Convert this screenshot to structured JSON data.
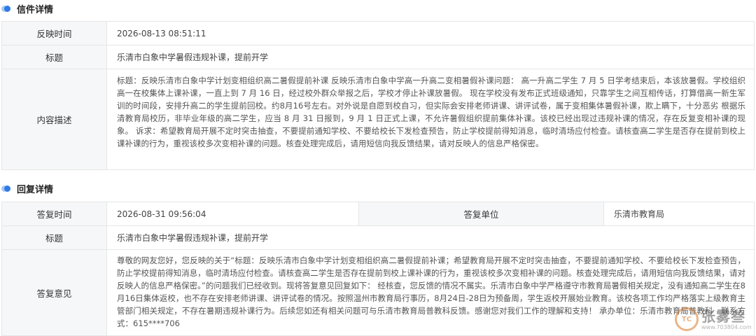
{
  "letter": {
    "section_title": "信件详情",
    "time_label": "反映时间",
    "time_value": "2026-08-13 08:51:11",
    "title_label": "标题",
    "title_value": "乐清市白象中学暑假违规补课，提前开学",
    "content_label": "内容描述",
    "content_value": "标题：反映乐清市白象中学计划变相组织高二暑假提前补课 反映乐清市白象中学高一升高二变相暑假补课问题： 高一升高二学生 7 月 5 日学考结束后，本该放暑假。学校组织高一在校集体上课补课，一直上到 7 月 16 日，经过校外群众举报之后，学校才停止补课放暑假。 现在学校没有发布正式班级通知，只靠学生之间互相传话，打算借高一新生军训的时间段，安排升高二的学生提前回校。约8月16号左右。对外说是自愿到校自习，但实际会安排老师讲课、讲评试卷，属于变相集体暑假补课，欺上瞒下，十分恶劣 根据乐清教育局校历，非毕业年级的高二学生，应当 8 月 31 日报到，9 月 1 日正式上课，不允许暑假组织提前集体补课。该校已经出现过违规补课的情况，存在反复变相补课的现象。 诉求：希望教育局开展不定时突击抽查，不要提前通知学校、不要给校长下发检查预告，防止学校提前得知消息，临时清场应付检查。请核查高二学生是否存在提前到校上课补课的行为，重视该校多次变相补课的问题。核查处理完成后，请用短信向我反馈结果，请对反映人的信息严格保密。"
  },
  "reply": {
    "section_title": "回复详情",
    "time_label": "答复时间",
    "time_value": "2026-08-31 09:56:04",
    "unit_label": "答复单位",
    "unit_value": "乐清市教育局",
    "title_label": "标题",
    "title_value": "乐清市白象中学暑假违规补课，提前开学",
    "opinion_label": "答复意见",
    "opinion_value": "尊敬的网友您好，您反映的关于“标题：反映乐清市白象中学计划变相组织高二暑假提前补课；希望教育局开展不定时突击抽查，不要提前通知学校、不要给校长下发检查预告，防止学校提前得知消息，临时清场应付检查。请核查高二学生是否存在提前到校上课补课的行为，重视该校多次变相补课的问题。核查处理完成后，请用短信向我反馈结果，请对反映人的信息严格保密。”的问题我们已经收到。现将答复意见回复如下： 经核查，您反馈的情况不属实。乐清市白象中学严格遵守市教育局暑假相关规定，没有通知高二学生在8月16日集体返校，也不存在安排老师讲课、讲评试卷的情况。按照温州市教育局行事历，8月24日-28日为预备周，学生返校开展始业教育。该校各项工作均严格落实上级教育主管部门相关规定，不存在暑期违规补课行为。后续您如还有相关问题可与乐清市教育局普教科反馈。感谢您对我们工作的理解和支持！ 承办单位：乐清市教育局普教科　联系方式：615****706"
  },
  "watermark": {
    "logo_text": "TC",
    "name": "张雾叁",
    "url": "www.703804.com"
  }
}
